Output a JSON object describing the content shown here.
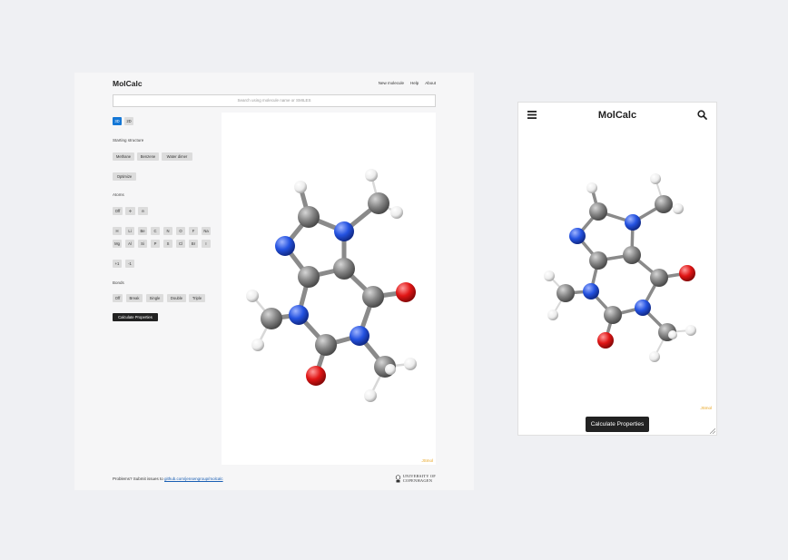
{
  "desktop": {
    "brand": "MolCalc",
    "nav": [
      "New molecule",
      "Help",
      "About"
    ],
    "search": {
      "placeholder": "Search using molecule name or SMILES"
    },
    "view_modes": [
      "3D",
      "2D"
    ],
    "active_view_mode": "3D",
    "starting_structure": {
      "label": "Starting structure",
      "options": [
        "Methane",
        "Benzene",
        "Water dimer"
      ]
    },
    "optimize_label": "Optimize",
    "atoms": {
      "label": "Atoms",
      "tools": [
        "Off",
        "✢",
        "⊖"
      ],
      "row1": [
        "H",
        "Li",
        "Be",
        "C",
        "N",
        "O",
        "F",
        "Na"
      ],
      "row2": [
        "Mg",
        "Al",
        "Si",
        "P",
        "S",
        "Cl",
        "Br",
        "I"
      ],
      "charges": [
        "+1",
        "-1"
      ]
    },
    "bonds": {
      "label": "Bonds",
      "options": [
        "Off",
        "Break",
        "Single",
        "Double",
        "Triple"
      ]
    },
    "calculate_label": "Calculate Properties",
    "viewer_credit": "JSmol",
    "footer": {
      "text": "Problems? Submit issues to",
      "link": "github.com/jensengroup/molcalc"
    },
    "university": {
      "line1": "UNIVERSITY OF",
      "line2": "COPENHAGEN"
    }
  },
  "mobile": {
    "brand": "MolCalc",
    "viewer_credit": "JSmol",
    "calculate_label": "Calculate Properties"
  },
  "colors": {
    "accent": "#1477d6",
    "carbon": "#808080",
    "nitrogen": "#2452e0",
    "oxygen": "#e01515",
    "hydrogen": "#f2f2f2"
  }
}
